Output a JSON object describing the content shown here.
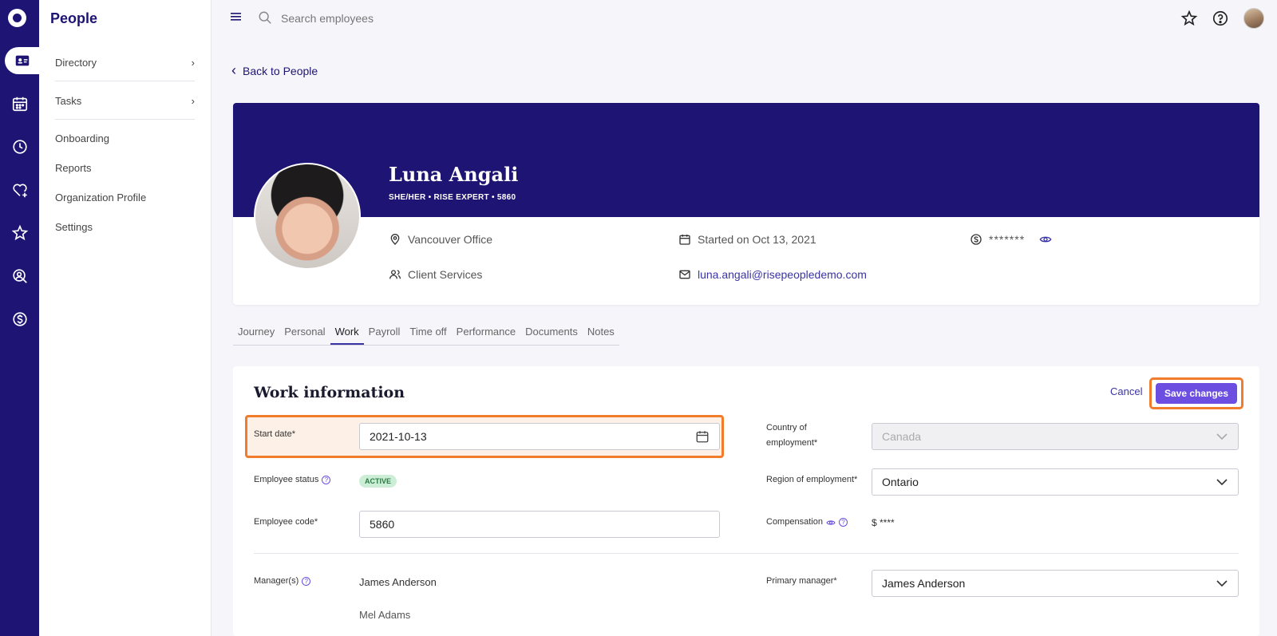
{
  "app": {
    "section_title": "People"
  },
  "sidenav": {
    "items": [
      {
        "label": "Directory",
        "has_chevron": true
      },
      {
        "label": "Tasks",
        "has_chevron": true
      },
      {
        "label": "Onboarding"
      },
      {
        "label": "Reports"
      },
      {
        "label": "Organization Profile"
      },
      {
        "label": "Settings"
      }
    ]
  },
  "topbar": {
    "search_placeholder": "Search employees"
  },
  "back_link": "Back to People",
  "profile": {
    "name": "Luna Angali",
    "meta": "SHE/HER  •  RISE EXPERT  •  5860",
    "location": "Vancouver Office",
    "start": "Started on Oct 13, 2021",
    "salary_masked": "*******",
    "department": "Client Services",
    "email": "luna.angali@risepeopledemo.com"
  },
  "tabs": [
    "Journey",
    "Personal",
    "Work",
    "Payroll",
    "Time off",
    "Performance",
    "Documents",
    "Notes"
  ],
  "active_tab": "Work",
  "work": {
    "title": "Work information",
    "cancel_label": "Cancel",
    "save_label": "Save changes",
    "start_date_label": "Start date*",
    "start_date_value": "2021-10-13",
    "employee_status_label": "Employee status",
    "employee_status_value": "ACTIVE",
    "employee_code_label": "Employee code*",
    "employee_code_value": "5860",
    "managers_label": "Manager(s)",
    "managers": [
      "James Anderson",
      "Mel Adams"
    ],
    "country_label_line1": "Country of",
    "country_label_line2": "employment*",
    "country_value": "Canada",
    "region_label": "Region of employment*",
    "region_value": "Ontario",
    "compensation_label": "Compensation",
    "compensation_value": "$ ****",
    "primary_manager_label": "Primary manager*",
    "primary_manager_value": "James Anderson"
  },
  "colors": {
    "brand": "#1e1473",
    "accent": "#6c4fe0",
    "highlight": "#f07c2c",
    "status_active": "#cdeed6"
  }
}
